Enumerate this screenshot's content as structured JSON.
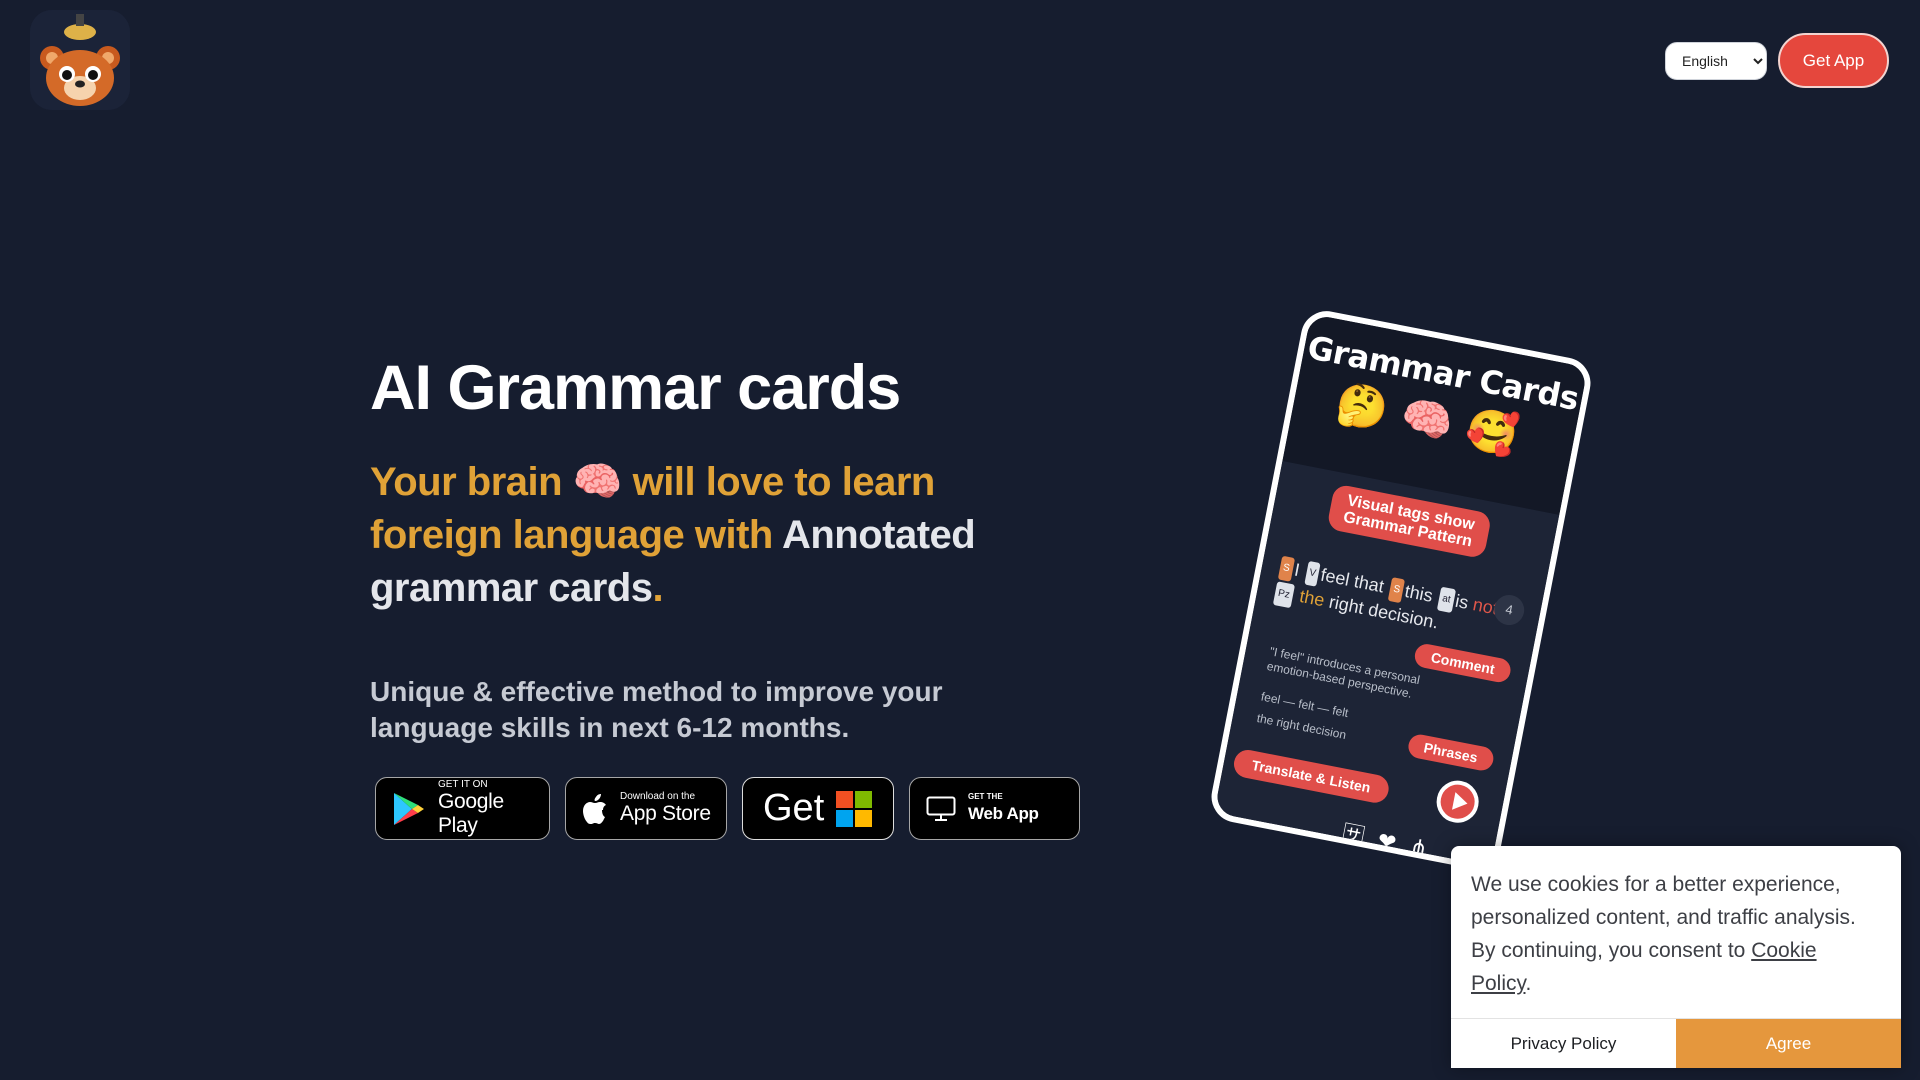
{
  "header": {
    "logo_icon": "bear-logo-icon",
    "language_options": [
      "English"
    ],
    "language_selected": "English",
    "get_app_label": "Get App"
  },
  "hero": {
    "title": "AI Grammar cards",
    "subtitle_part1": "Your brain",
    "subtitle_emoji": "🧠",
    "subtitle_part2": "will love to learn foreign language with",
    "subtitle_part3": "Annotated grammar cards",
    "subtitle_dot": ".",
    "description": "Unique & effective method to improve your language skills in next 6-12 months."
  },
  "stores": {
    "google_small": "GET IT ON",
    "google_big": "Google Play",
    "apple_small": "Download on the",
    "apple_big": "App Store",
    "ms_get": "Get",
    "web_small": "GET THE",
    "web_big": "Web App"
  },
  "phone": {
    "title": "Grammar Cards",
    "emojis": "🤔🧠🥰",
    "tag_pattern": "Visual tags show Grammar Pattern",
    "page_number": "4",
    "sentence_words": [
      "I",
      "feel",
      "that",
      "this",
      "is",
      "not",
      "the",
      "right",
      "decision."
    ],
    "comment_label": "Comment",
    "comment_text": "\"I feel\" introduces a personal emotion-based perspective.",
    "phrase1": "feel — felt — felt",
    "phrase2": "the right decision",
    "phrases_label": "Phrases",
    "translate_label": "Translate & Listen"
  },
  "cookie": {
    "text": "We use cookies for a better experience, personalized content, and traffic analysis. By continuing, you consent to",
    "link": "Cookie Policy",
    "end": ".",
    "privacy_label": "Privacy Policy",
    "agree_label": "Agree"
  },
  "colors": {
    "background": "#161d2f",
    "accent_red": "#e5473d",
    "highlight_orange": "#e0a237",
    "agree_orange": "#e5973d"
  }
}
